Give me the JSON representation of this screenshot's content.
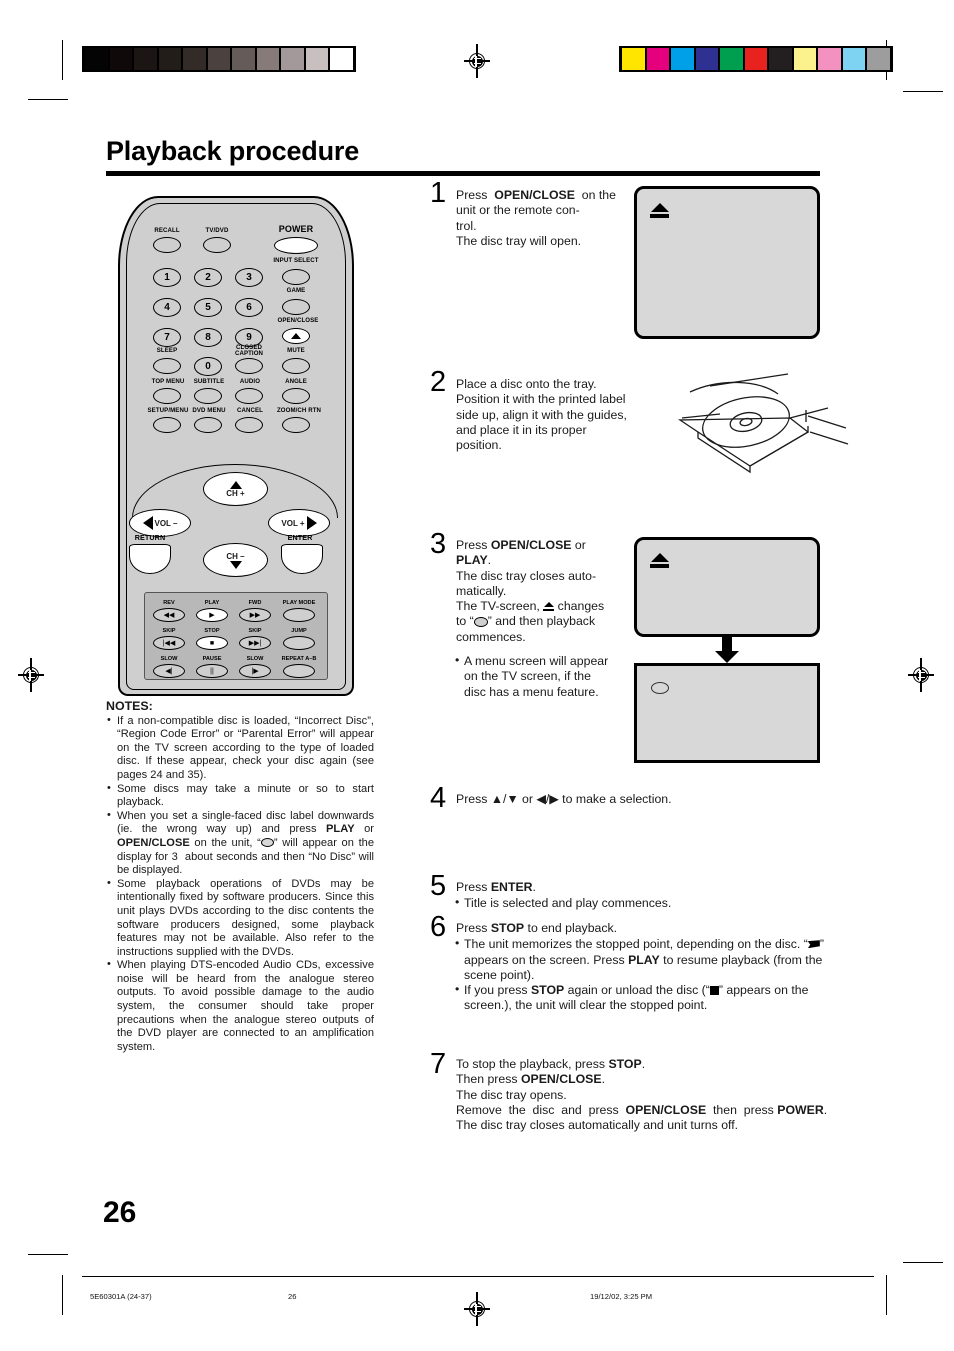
{
  "page": {
    "title": "Playback procedure",
    "number": "26"
  },
  "printer_marks": {
    "grayscale_bar": [
      "#050404",
      "#0f0a09",
      "#1b1513",
      "#231d1a",
      "#332b28",
      "#4b423f",
      "#655b58",
      "#867b78",
      "#a3999a",
      "#c8bfbf",
      "#ffffff"
    ],
    "color_bar": [
      "#ffe500",
      "#e5007e",
      "#00a0e9",
      "#2e3192",
      "#009e4f",
      "#e7221f",
      "#231f20",
      "#fbf18d",
      "#f391c0",
      "#7ed3f2",
      "#9d9d9d"
    ]
  },
  "remote": {
    "name": "remote-control-diagram",
    "row_top": [
      "RECALL",
      "TV/DVD",
      "POWER"
    ],
    "numbers": [
      "1",
      "2",
      "3",
      "4",
      "5",
      "6",
      "7",
      "8",
      "9",
      "0"
    ],
    "right_column": [
      "INPUT SELECT",
      "GAME",
      "OPEN/CLOSE",
      "MUTE"
    ],
    "row_sleep": [
      "SLEEP",
      "CLOSED CAPTION"
    ],
    "closed_caption_line1": "CLOSED",
    "closed_caption_line2": "CAPTION",
    "row_menu": [
      "TOP MENU",
      "SUBTITLE",
      "AUDIO",
      "ANGLE"
    ],
    "row_setup": [
      "SETUP/MENU",
      "DVD MENU",
      "CANCEL",
      "ZOOM/CH RTN"
    ],
    "nav": {
      "ch_up": "CH +",
      "ch_down": "CH –",
      "vol_down": "VOL –",
      "vol_up": "VOL +",
      "return": "RETURN",
      "enter": "ENTER"
    },
    "transport": {
      "labels": [
        "REV",
        "PLAY",
        "FWD",
        "PLAY MODE",
        "SKIP",
        "STOP",
        "SKIP",
        "JUMP",
        "SLOW",
        "PAUSE",
        "SLOW",
        "REPEAT A–B"
      ],
      "glyphs": [
        "◀◀",
        "▶",
        "▶▶",
        "",
        "|◀◀",
        "■",
        "▶▶|",
        "",
        "◀|",
        "||",
        "|▶",
        ""
      ]
    }
  },
  "notes": {
    "heading": "NOTES:",
    "items": [
      "If a non-compatible disc is loaded, “Incorrect Disc”, “Region Code Error” or “Parental Error” will appear on the TV screen according to the type of loaded disc. If these appear, check your disc again (see pages 24 and 35).",
      "Some discs may take a minute or so to start playback.",
      "When you set a single-faced disc label downwards (ie. the wrong way up) and press PLAY or OPEN/CLOSE on the unit, “◍” will appear on the display for 3 about seconds and then “No Disc” will be displayed.",
      "Some playback operations of DVDs may be intentionally fixed by software producers. Since this unit plays DVDs according to the disc contents the software producers designed, some playback features may not be available. Also refer to the instructions supplied with the DVDs.",
      "When playing DTS-encoded Audio CDs, excessive noise will be heard from the analogue stereo outputs. To avoid possible damage to the audio system, the consumer should take proper precautions when the analogue stereo outputs of the DVD player are connected to an amplification system."
    ]
  },
  "steps": {
    "step1": {
      "num": "1",
      "lines": [
        "Press  OPEN/CLOSE  on",
        "the unit or the remote con-",
        "trol.",
        "The disc tray will open."
      ]
    },
    "step2": {
      "num": "2",
      "lines": [
        "Place a disc onto the tray.",
        "Position it with the printed",
        "label side up, align it with",
        "the guides, and place it in",
        "its proper position."
      ]
    },
    "step3": {
      "num": "3",
      "lines": [
        "Press OPEN/CLOSE or",
        "PLAY.",
        "The disc tray closes auto-",
        "matically.",
        "The TV-screen, ⏏ changes",
        "to “◍” and then playback",
        "commences."
      ],
      "bullet": "A menu screen will appear on the TV screen, if the disc has a menu feature."
    },
    "step4": {
      "num": "4",
      "text": "Press ▲/▼ or ◀/▶ to make a selection."
    },
    "step5": {
      "num": "5",
      "text": "Press ENTER.",
      "bullet": "Title is selected and play commences."
    },
    "step6": {
      "num": "6",
      "text": "Press STOP to end playback.",
      "bullets": [
        "The unit memorizes the stopped point, depending on the disc. “◤” appears on the screen. Press PLAY to resume playback (from the scene point).",
        "If you press STOP again or unload the disc (“■” appears on the screen.), the unit will clear the stopped point."
      ]
    },
    "step7": {
      "num": "7",
      "lines": [
        "To stop the playback, press STOP.",
        "Then press OPEN/CLOSE.",
        "The disc tray opens.",
        "Remove  the  disc  and  press  OPEN/CLOSE  then  press POWER.",
        "The disc tray closes automatically and unit turns off."
      ]
    }
  },
  "footer": {
    "doc_id": "5E60301A (24-37)",
    "page": "26",
    "timestamp": "19/12/02, 3:25 PM"
  }
}
